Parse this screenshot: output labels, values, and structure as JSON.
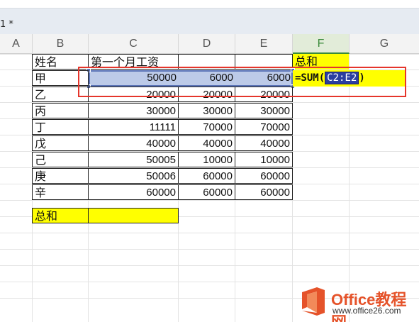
{
  "window": {
    "title": "1 *"
  },
  "columns": [
    "A",
    "B",
    "C",
    "D",
    "E",
    "F",
    "G"
  ],
  "active_column": "F",
  "table": {
    "header": {
      "name": "姓名",
      "month1": "第一个月工资",
      "col_d": "",
      "col_e": ""
    },
    "rows": [
      {
        "name": "甲",
        "c": "50000",
        "d": "6000",
        "e": "6000"
      },
      {
        "name": "乙",
        "c": "20000",
        "d": "20000",
        "e": "20000"
      },
      {
        "name": "丙",
        "c": "30000",
        "d": "30000",
        "e": "30000"
      },
      {
        "name": "丁",
        "c": "11111",
        "d": "70000",
        "e": "70000"
      },
      {
        "name": "戊",
        "c": "40000",
        "d": "40000",
        "e": "40000"
      },
      {
        "name": "己",
        "c": "50005",
        "d": "10000",
        "e": "10000"
      },
      {
        "name": "庚",
        "c": "50006",
        "d": "60000",
        "e": "60000"
      },
      {
        "name": "辛",
        "c": "60000",
        "d": "60000",
        "e": "60000"
      }
    ],
    "total_label": "总和"
  },
  "f_column": {
    "header": "总和",
    "formula_prefix": "=SUM(",
    "formula_ref": "C2:E2",
    "formula_suffix": ")"
  },
  "colors": {
    "highlight": "#ffff00",
    "selection": "#bccae8",
    "annotation": "#e5352b"
  },
  "watermark": {
    "name": "Office教程网",
    "url": "www.office26.com"
  }
}
